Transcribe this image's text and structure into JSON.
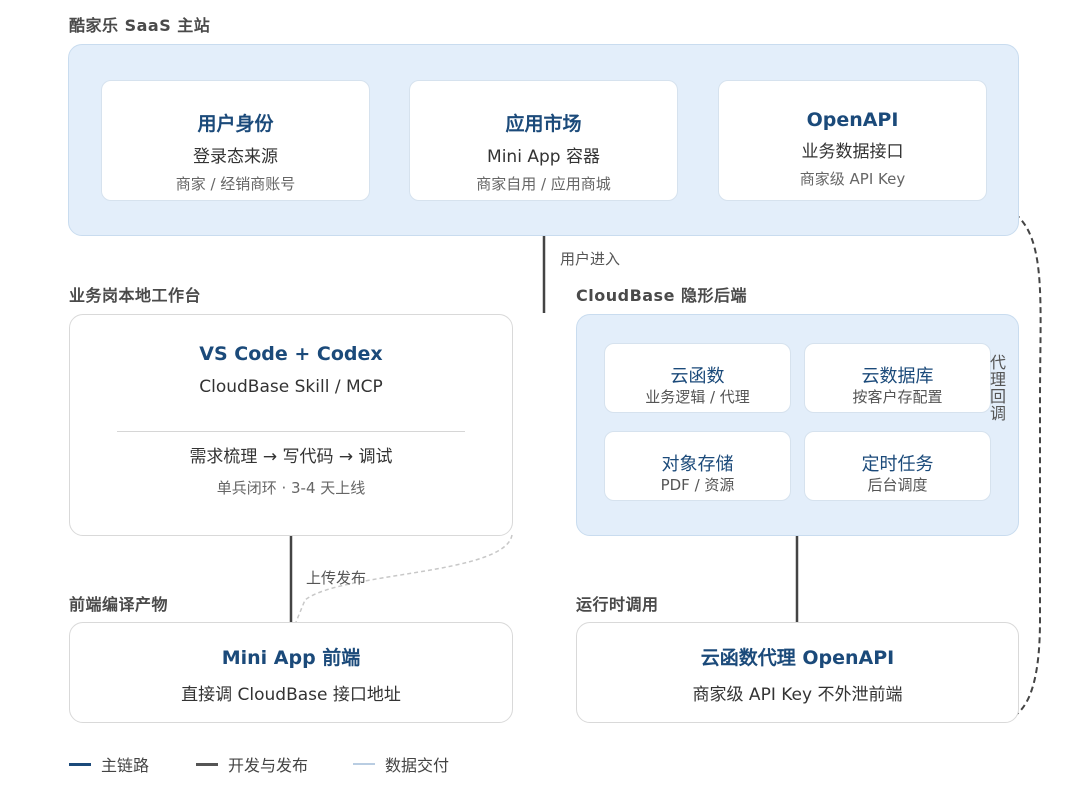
{
  "saas": {
    "label": "酷家乐 SaaS 主站",
    "cards": [
      {
        "title": "用户身份",
        "sub": "登录态来源",
        "note": "商家 / 经销商账号"
      },
      {
        "title": "应用市场",
        "sub": "Mini App 容器",
        "note": "商家自用 / 应用商城"
      },
      {
        "title": "OpenAPI",
        "sub": "业务数据接口",
        "note": "商家级 API Key"
      }
    ]
  },
  "edges": {
    "user_enter": "用户进入",
    "upload_publish": "上传发布",
    "proxy_callback": "代理回调"
  },
  "workbench": {
    "label": "业务岗本地工作台",
    "title": "VS Code + Codex",
    "sub": "CloudBase Skill / MCP",
    "flow": "需求梳理 → 写代码 → 调试",
    "note": "单兵闭环 · 3-4 天上线"
  },
  "cloudbase": {
    "label": "CloudBase 隐形后端",
    "cards": [
      {
        "title": "云函数",
        "note": "业务逻辑 / 代理"
      },
      {
        "title": "云数据库",
        "note": "按客户存配置"
      },
      {
        "title": "对象存储",
        "note": "PDF / 资源"
      },
      {
        "title": "定时任务",
        "note": "后台调度"
      }
    ]
  },
  "frontend": {
    "label": "前端编译产物",
    "title": "Mini App 前端",
    "sub": "直接调 CloudBase 接口地址"
  },
  "runtime": {
    "label": "运行时调用",
    "title": "云函数代理 OpenAPI",
    "sub": "商家级 API Key 不外泄前端"
  },
  "legend": [
    {
      "label": "主链路",
      "color": "#1b4a7a"
    },
    {
      "label": "开发与发布",
      "color": "#555555"
    },
    {
      "label": "数据交付",
      "color": "#b9cde2"
    }
  ]
}
